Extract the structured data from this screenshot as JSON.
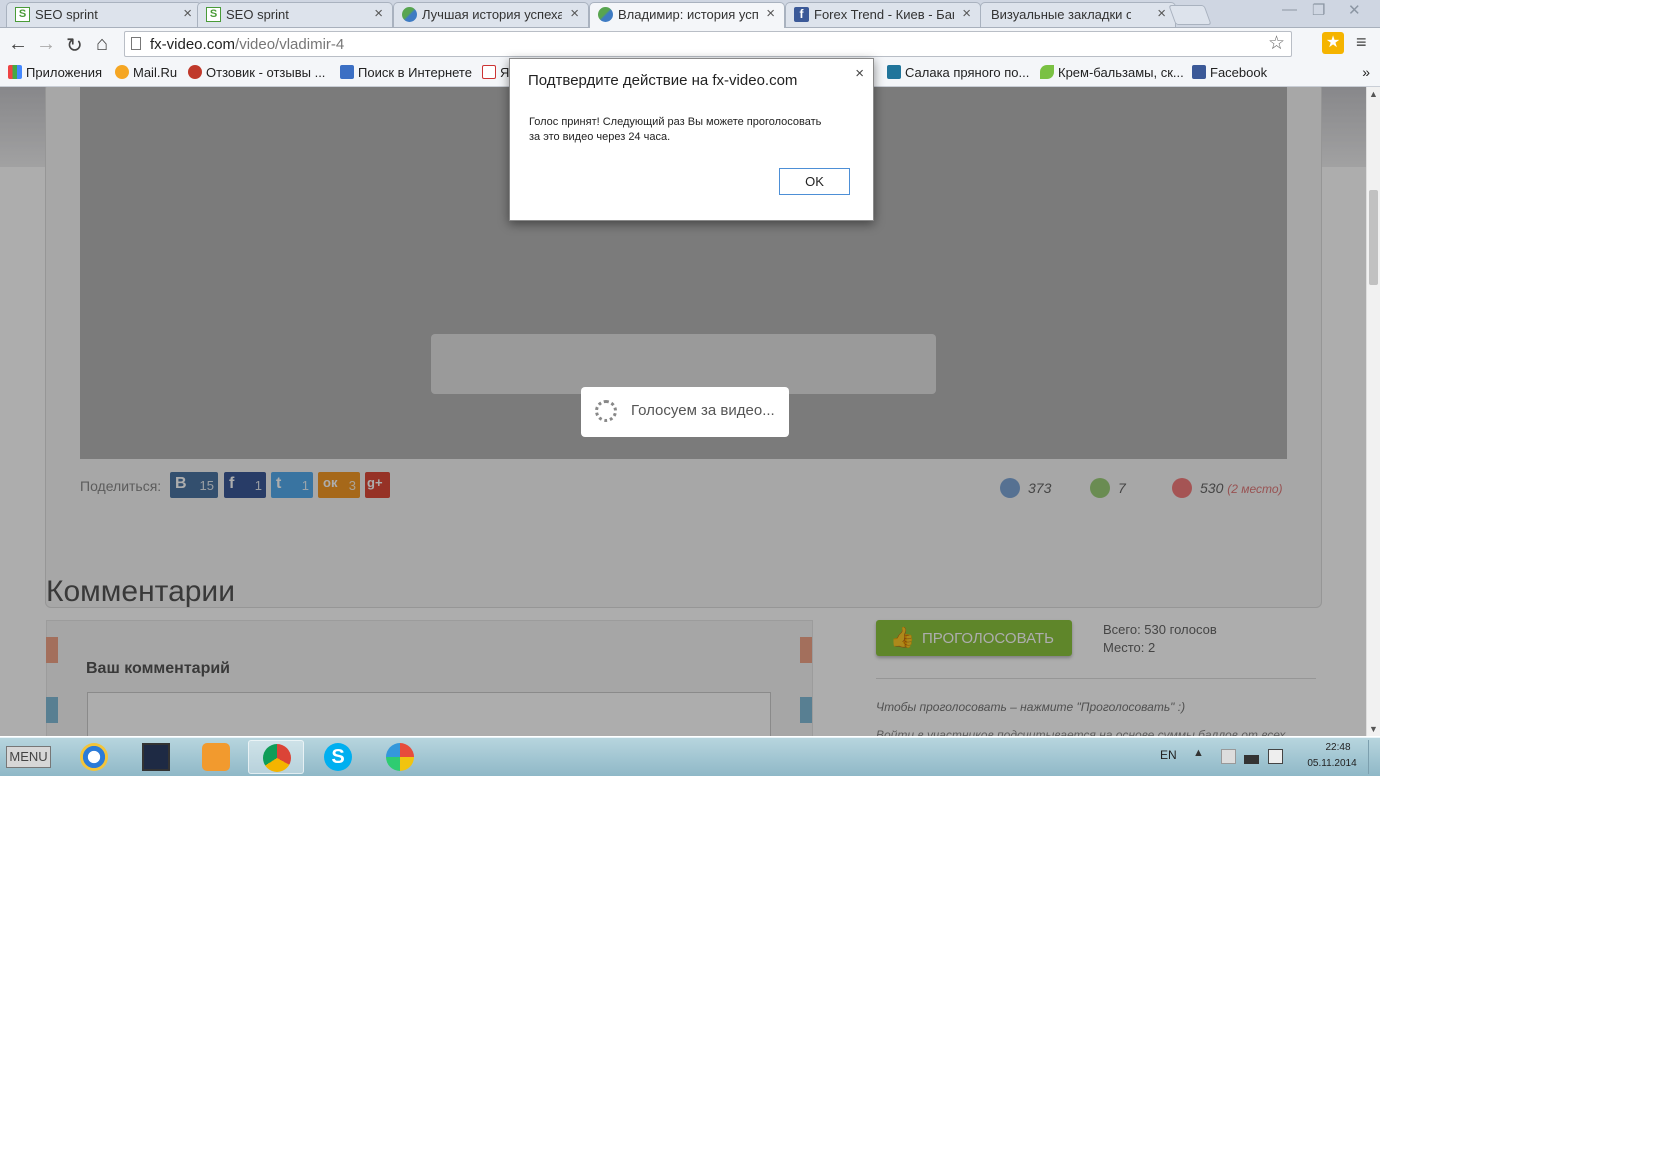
{
  "browser": {
    "tabs": [
      {
        "title": "SEO sprint",
        "icon": "seo-sprint-icon",
        "active": false
      },
      {
        "title": "SEO sprint",
        "icon": "seo-sprint-icon",
        "active": false
      },
      {
        "title": "Лучшая история успеха",
        "icon": "globe-icon",
        "active": false
      },
      {
        "title": "Владимир: история успе",
        "icon": "globe-icon",
        "active": true
      },
      {
        "title": "Forex Trend - Киев - Банк",
        "icon": "facebook-icon",
        "active": false
      },
      {
        "title": "Визуальные закладки онла",
        "icon": "page-icon",
        "active": false
      }
    ],
    "url_host": "fx-video.com",
    "url_path": "/video/vladimir-4",
    "bookmarks": [
      {
        "label": "Приложения",
        "icon": "apps-icon"
      },
      {
        "label": "Mail.Ru",
        "icon": "mailru-icon"
      },
      {
        "label": "Отзовик - отзывы ...",
        "icon": "otzovik-icon"
      },
      {
        "label": "Поиск в Интернете",
        "icon": "search-icon"
      },
      {
        "label": "Я",
        "icon": "yandex-icon"
      },
      {
        "label": "Салака пряного по...",
        "icon": "wordpress-icon"
      },
      {
        "label": "Крем-бальзамы, ск...",
        "icon": "leaf-icon"
      },
      {
        "label": "Facebook",
        "icon": "facebook-icon"
      }
    ],
    "bookmarks_more": "»"
  },
  "page": {
    "share_label": "Поделиться:",
    "share": [
      {
        "glyph": "В",
        "count": "15",
        "color": "#4c75a3"
      },
      {
        "glyph": "f",
        "count": "1",
        "color": "#3b5998"
      },
      {
        "glyph": "t",
        "count": "1",
        "color": "#55acee"
      },
      {
        "glyph": "ок",
        "count": "3",
        "color": "#f59a25"
      },
      {
        "glyph": "g+",
        "count": "",
        "color": "#dd4b39"
      }
    ],
    "stats": {
      "views": "373",
      "comments": "7",
      "likes": "530",
      "place": "(2 место)"
    },
    "comments_title": "Комментарии",
    "your_comment": "Ваш комментарий",
    "vote_button": "ПРОГОЛОСОВАТЬ",
    "vote_total": "Всего: 530 голосов",
    "vote_place": "Место: 2",
    "vote_hint": "Чтобы проголосовать – нажмите \"Проголосовать\" :)",
    "vote_hint2": "Войти в участников подсчитывается на основе суммы баллов от всех...",
    "voting_status": "Голосуем за видео..."
  },
  "dialog": {
    "title": "Подтвердите действие на fx-video.com",
    "message": "Голос принят! Следующий раз Вы можете проголосовать за это видео через 24 часа.",
    "ok": "OK",
    "close": "×"
  },
  "taskbar": {
    "start_label": "MENU",
    "apps": [
      "internet-explorer-icon",
      "monitor-icon",
      "media-player-icon",
      "chrome-icon",
      "skype-icon",
      "paint-icon"
    ],
    "active_app": 3,
    "lang": "EN",
    "time": "22:48",
    "date": "05.11.2014"
  },
  "colors": {
    "vote_green": "#8cc63f",
    "ok_border": "#4d8fd6",
    "place_red": "#e07a7a"
  }
}
